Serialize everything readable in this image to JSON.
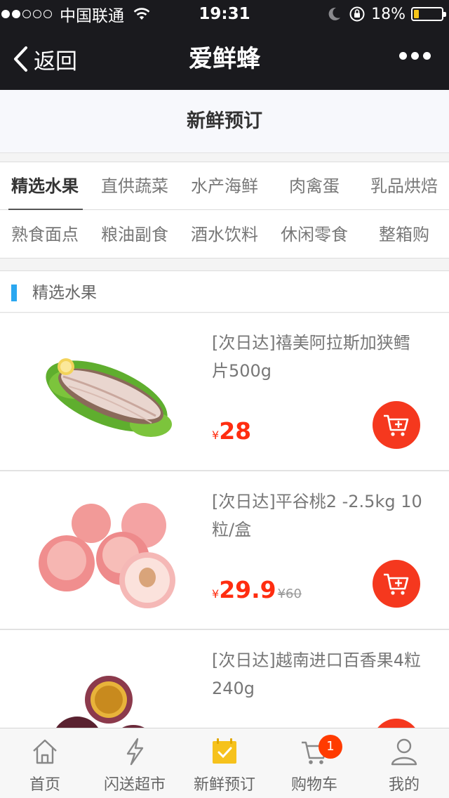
{
  "status_bar": {
    "signal_dots_filled": 2,
    "signal_dots_total": 5,
    "carrier": "中国联通",
    "time": "19:31",
    "battery_percent": "18%",
    "battery_level": 0.18,
    "battery_color": "#f5c518",
    "icons": [
      "wifi-icon",
      "moon-icon",
      "rotation-lock-icon",
      "battery-icon"
    ]
  },
  "nav": {
    "back_label": "返回",
    "title": "爱鲜蜂",
    "more_icon": "more-dots-icon"
  },
  "page": {
    "title": "新鲜预订"
  },
  "categories": {
    "row1": [
      "精选水果",
      "直供蔬菜",
      "水产海鲜",
      "肉禽蛋",
      "乳品烘焙"
    ],
    "row2": [
      "熟食面点",
      "粮油副食",
      "酒水饮料",
      "休闲零食",
      "整箱购"
    ],
    "active": "精选水果"
  },
  "section": {
    "label": "精选水果",
    "accent_color": "#2aa7f0"
  },
  "products": [
    {
      "name": "[次日达]禧美阿拉斯加狭鳕片500g",
      "currency": "¥",
      "price": "28",
      "old_price": "",
      "image": "fish-fillet-image"
    },
    {
      "name": "[次日达]平谷桃2 -2.5kg 10粒/盒",
      "currency": "¥",
      "price": "29.9",
      "old_price": "¥60",
      "image": "peach-image"
    },
    {
      "name": "[次日达]越南进口百香果4粒 240g",
      "currency": "¥",
      "price": "",
      "old_price": "",
      "image": "passion-fruit-image"
    }
  ],
  "colors": {
    "price": "#ff2d10",
    "cart_button": "#f5381e",
    "header_bg": "#1a1a1e",
    "active_tab": "#f6c21c"
  },
  "tabbar": {
    "tabs": [
      {
        "label": "首页",
        "icon": "home-icon"
      },
      {
        "label": "闪送超市",
        "icon": "lightning-icon"
      },
      {
        "label": "新鲜预订",
        "icon": "calendar-check-icon"
      },
      {
        "label": "购物车",
        "icon": "cart-icon"
      },
      {
        "label": "我的",
        "icon": "user-icon"
      }
    ],
    "active": "新鲜预订",
    "cart_badge": "1"
  }
}
